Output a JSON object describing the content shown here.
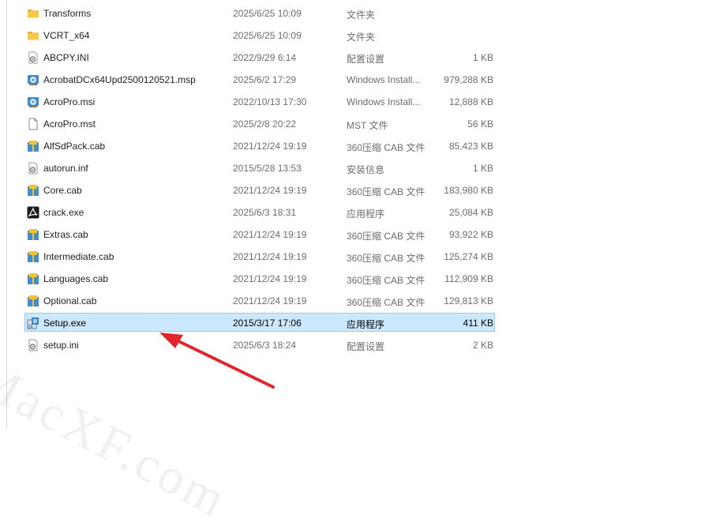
{
  "files": [
    {
      "name": "Transforms",
      "date": "2025/6/25 10:09",
      "type": "文件夹",
      "size": "",
      "icon": "folder-icon"
    },
    {
      "name": "VCRT_x64",
      "date": "2025/6/25 10:09",
      "type": "文件夹",
      "size": "",
      "icon": "folder-icon"
    },
    {
      "name": "ABCPY.INI",
      "date": "2022/9/29 6:14",
      "type": "配置设置",
      "size": "1 KB",
      "icon": "ini-file-icon"
    },
    {
      "name": "AcrobatDCx64Upd2500120521.msp",
      "date": "2025/6/2 17:29",
      "type": "Windows Install...",
      "size": "979,288 KB",
      "icon": "installer-icon"
    },
    {
      "name": "AcroPro.msi",
      "date": "2022/10/13 17:30",
      "type": "Windows Install...",
      "size": "12,888 KB",
      "icon": "installer-icon"
    },
    {
      "name": "AcroPro.mst",
      "date": "2025/2/8 20:22",
      "type": "MST 文件",
      "size": "56 KB",
      "icon": "generic-file-icon"
    },
    {
      "name": "AlfSdPack.cab",
      "date": "2021/12/24 19:19",
      "type": "360压缩 CAB 文件",
      "size": "85,423 KB",
      "icon": "cab-archive-icon"
    },
    {
      "name": "autorun.inf",
      "date": "2015/5/28 13:53",
      "type": "安装信息",
      "size": "1 KB",
      "icon": "ini-file-icon"
    },
    {
      "name": "Core.cab",
      "date": "2021/12/24 19:19",
      "type": "360压缩 CAB 文件",
      "size": "183,980 KB",
      "icon": "cab-archive-icon"
    },
    {
      "name": "crack.exe",
      "date": "2025/6/3 18:31",
      "type": "应用程序",
      "size": "25,084 KB",
      "icon": "acrobat-exe-icon"
    },
    {
      "name": "Extras.cab",
      "date": "2021/12/24 19:19",
      "type": "360压缩 CAB 文件",
      "size": "93,922 KB",
      "icon": "cab-archive-icon"
    },
    {
      "name": "Intermediate.cab",
      "date": "2021/12/24 19:19",
      "type": "360压缩 CAB 文件",
      "size": "125,274 KB",
      "icon": "cab-archive-icon"
    },
    {
      "name": "Languages.cab",
      "date": "2021/12/24 19:19",
      "type": "360压缩 CAB 文件",
      "size": "112,909 KB",
      "icon": "cab-archive-icon"
    },
    {
      "name": "Optional.cab",
      "date": "2021/12/24 19:19",
      "type": "360压缩 CAB 文件",
      "size": "129,813 KB",
      "icon": "cab-archive-icon"
    },
    {
      "name": "Setup.exe",
      "date": "2015/3/17 17:06",
      "type": "应用程序",
      "size": "411 KB",
      "icon": "setup-exe-icon",
      "selected": true
    },
    {
      "name": "setup.ini",
      "date": "2025/6/3 18:24",
      "type": "配置设置",
      "size": "2 KB",
      "icon": "ini-file-icon"
    }
  ],
  "watermark": "MacXF.com",
  "colors": {
    "selection": "#cce8ff",
    "selection_border": "#99c9ef",
    "arrow": "#e0262b",
    "folder": "#f7c948"
  }
}
